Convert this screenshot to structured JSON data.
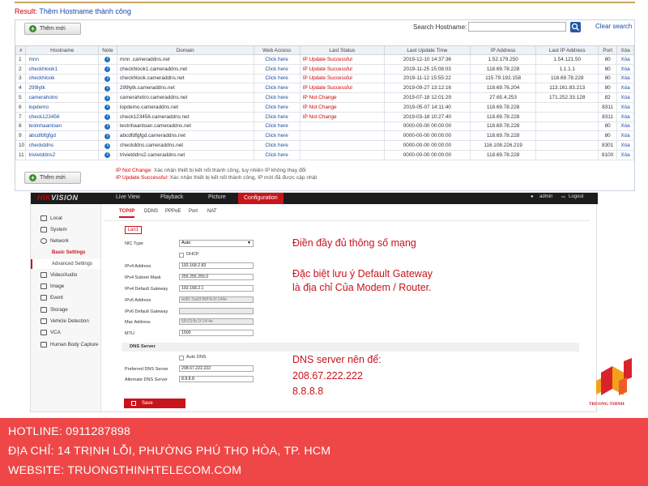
{
  "ddns_panel": {
    "result_label": "Result:",
    "result_message": "Thêm Hostname thành công",
    "add_button": "Thêm mới",
    "search_label": "Search Hostname:",
    "search_value": "",
    "clear_search": "Clear search",
    "columns": [
      "#",
      "Hostname",
      "Note",
      "Domain",
      "Web Access",
      "Last Status",
      "Last Update Time",
      "IP Address",
      "Last IP Address",
      "Port",
      "Xóa"
    ],
    "rows": [
      [
        "1",
        "mnn",
        "i",
        "mnn            .cameraddns.net",
        "Click here",
        "IP Update Successful",
        "2019-12-10 14:37:36",
        "1.52.179.250",
        "1.54.121.50",
        "80",
        "Xóa"
      ],
      [
        "2",
        "checkhlook1",
        "i",
        "checkhlook1.cameraddns.net",
        "Click here",
        "IP Update Successful",
        "2019-11-25 15:08:03",
        "118.69.78.228",
        "1.1.1.1",
        "80",
        "Xóa"
      ],
      [
        "3",
        "checkhlook",
        "i",
        "checkhlook.cameraddns.net",
        "Click here",
        "IP Update Successful",
        "2019-11-12 15:55:22",
        "115.79.192.158",
        "118.69.78.228",
        "80",
        "Xóa"
      ],
      [
        "4",
        "299lytk",
        "i",
        "299lytk.cameraddns.net",
        "Click here",
        "IP Update Successful",
        "2019-09-27 13:12:16",
        "118.69.76.204",
        "113.161.83.213",
        "80",
        "Xóa"
      ],
      [
        "5",
        "camerahotro",
        "i",
        "camerahotro.cameraddns.net",
        "Click here",
        "IP Not Change",
        "2019-07-18 12:01:29",
        "27.65.4.253",
        "171.252.33.128",
        "82",
        "Xóa"
      ],
      [
        "6",
        "lopdemo",
        "i",
        "lopdemo.cameraddns.net",
        "Click here",
        "IP Not Change",
        "2019-05-07 14:11:40",
        "118.69.78.228",
        "",
        "8311",
        "Xóa"
      ],
      [
        "7",
        "check123456",
        "i",
        "check123456.cameraddns.net",
        "Click here",
        "IP Not Change",
        "2019-03-18 10:27:40",
        "118.69.78.228",
        "",
        "8311",
        "Xóa"
      ],
      [
        "8",
        "testnhaantoan",
        "i",
        "testnhaantoan.cameraddns.net",
        "Click here",
        "",
        "0000-00-00 00:00:00",
        "118.69.78.228",
        "",
        "80",
        "Xóa"
      ],
      [
        "9",
        "abcdfdfgfgd",
        "i",
        "abcdfdfgfgd.cameraddns.net",
        "Click here",
        "",
        "0000-00-00 00:00:00",
        "118.69.78.228",
        "",
        "80",
        "Xóa"
      ],
      [
        "10",
        "checkddns",
        "i",
        "checkddns.cameraddns.net",
        "Click here",
        "",
        "0000-00-00 00:00:00",
        "116.108.226.219",
        "",
        "8301",
        "Xóa"
      ],
      [
        "11",
        "trivietddns2",
        "i",
        "trivietddns2.cameraddns.net",
        "Click here",
        "",
        "0000-00-00 00:00:00",
        "118.69.78.228",
        "",
        "8100",
        "Xóa"
      ]
    ],
    "note_not_change_key": "IP Not Change:",
    "note_not_change_text": "Xác nhận thiết bị kết nối thành công, tuy nhiên IP không thay đổi",
    "note_success_key": "IP Update Successful:",
    "note_success_text": "Xác nhận thiết bị kết nối thành công, IP mới đã được cập nhật"
  },
  "hikvision": {
    "logo_red": "HIK",
    "logo_grey": "VISION",
    "menu": [
      "Live View",
      "Playback",
      "Picture"
    ],
    "menu_active": "Configuration",
    "user": "admin",
    "logout": "Logout",
    "sidebar": [
      "Local",
      "System",
      "Network"
    ],
    "sidebar_network_sub": [
      "Basic Settings",
      "Advanced Settings"
    ],
    "sidebar_rest": [
      "Video/Audio",
      "Image",
      "Event",
      "Storage",
      "Vehicle Detection",
      "VCA",
      "Human Body Capture"
    ],
    "tabs": [
      "TCP/IP",
      "DDNS",
      "PPPoE",
      "Port",
      "NAT"
    ],
    "lan_tab": "Lan1",
    "fields": {
      "nic_type_label": "NIC Type",
      "nic_type_value": "Auto",
      "dhcp_label": "DHCP",
      "ipv4_label": "IPv4 Address",
      "ipv4_value": "192.168.2.83",
      "mask_label": "IPv4 Subnet Mask",
      "mask_value": "255.255.255.0",
      "gw_label": "IPv4 Default Gateway",
      "gw_value": "192.168.2.1",
      "ipv6_label": "IPv6 Address",
      "ipv6_value": "fe80::5a03:fbff:fe1f:144e",
      "ipv6_gw_label": "IPv6 Default Gateway",
      "ipv6_gw_value": "",
      "mac_label": "Mac Address",
      "mac_value": "58:03:fb:1f:14:4e",
      "mtu_label": "MTU",
      "mtu_value": "1500",
      "dns_section": "DNS Server",
      "auto_dns_label": "Auto DNS",
      "pref_dns_label": "Preferred DNS Server",
      "pref_dns_value": "208.67.222.222",
      "alt_dns_label": "Alternate DNS Server",
      "alt_dns_value": "8.8.8.8"
    },
    "save": "Save"
  },
  "annotations": {
    "a1": "Điền đầy đủ thông số mạng",
    "a2": "Đặc biệt lưu ý Default Gateway",
    "a3": "là địa chỉ Của Modem / Router.",
    "a4": "DNS server nên để:",
    "a5": "208.67.222.222",
    "a6": "8.8.8.8"
  },
  "brand": {
    "name": "TRUONG THINH"
  },
  "footer": {
    "hotline": "HOTLINE: 0911287898",
    "address": "ĐỊA CHỈ: 14 TRỊNH LỖI, PHƯỜNG PHÚ THỌ HÒA, TP. HCM",
    "website": "WEBSITE: TRUONGTHINHTELECOM.COM"
  },
  "colors": {
    "accent_red": "#c8141c",
    "footer_bg": "#ef4747",
    "link_blue": "#1a4aa8"
  }
}
